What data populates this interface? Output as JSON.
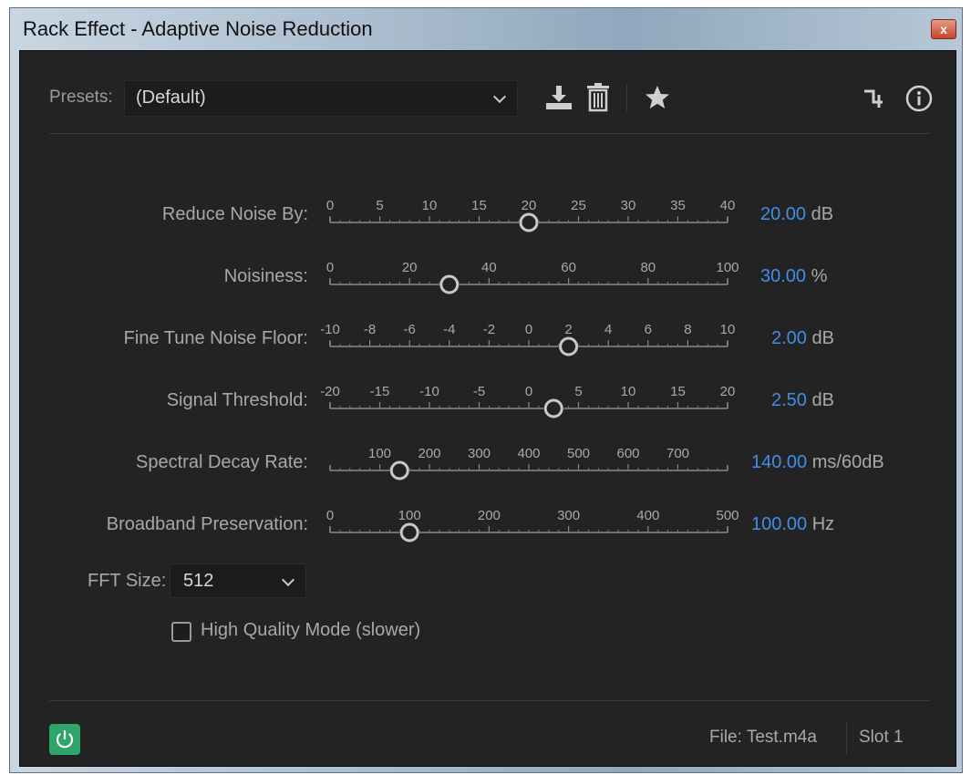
{
  "window": {
    "title": "Rack Effect - Adaptive Noise Reduction",
    "close_label": "x"
  },
  "toolbar": {
    "presets_label": "Presets:",
    "preset_value": "(Default)",
    "icons": [
      "save-preset-icon",
      "delete-preset-icon",
      "favorite-star-icon",
      "routing-icon",
      "info-icon"
    ]
  },
  "params": [
    {
      "label": "Reduce Noise By:",
      "value": "20.00",
      "unit": "dB",
      "min": 0,
      "max": 40,
      "current": 20,
      "ticks": [
        "0",
        "5",
        "10",
        "15",
        "20",
        "25",
        "30",
        "35",
        "40"
      ]
    },
    {
      "label": "Noisiness:",
      "value": "30.00",
      "unit": "%",
      "min": 0,
      "max": 100,
      "current": 30,
      "ticks": [
        "0",
        "20",
        "40",
        "60",
        "80",
        "100"
      ]
    },
    {
      "label": "Fine Tune Noise Floor:",
      "value": "2.00",
      "unit": "dB",
      "min": -10,
      "max": 10,
      "current": 2,
      "ticks": [
        "-10",
        "-8",
        "-6",
        "-4",
        "-2",
        "0",
        "2",
        "4",
        "6",
        "8",
        "10"
      ]
    },
    {
      "label": "Signal Threshold:",
      "value": "2.50",
      "unit": "dB",
      "min": -20,
      "max": 20,
      "current": 2.5,
      "ticks": [
        "-20",
        "-15",
        "-10",
        "-5",
        "0",
        "5",
        "10",
        "15",
        "20"
      ]
    },
    {
      "label": "Spectral Decay Rate:",
      "value": "140.00",
      "unit": "ms/60dB",
      "min": 0,
      "max": 800,
      "current": 140,
      "ticks": [
        "100",
        "200",
        "300",
        "400",
        "500",
        "600",
        "700"
      ]
    },
    {
      "label": "Broadband Preservation:",
      "value": "100.00",
      "unit": "Hz",
      "min": 0,
      "max": 500,
      "current": 100,
      "ticks": [
        "0",
        "100",
        "200",
        "300",
        "400",
        "500"
      ]
    }
  ],
  "fft": {
    "label": "FFT Size:",
    "value": "512"
  },
  "high_quality": {
    "label": "High Quality Mode (slower)",
    "checked": false
  },
  "footer": {
    "file": "File: Test.m4a",
    "slot": "Slot 1"
  },
  "colors": {
    "accent_value": "#3f8fe9",
    "power": "#2ea56a",
    "arrow": "#d11a1a",
    "panel": "#232323"
  }
}
